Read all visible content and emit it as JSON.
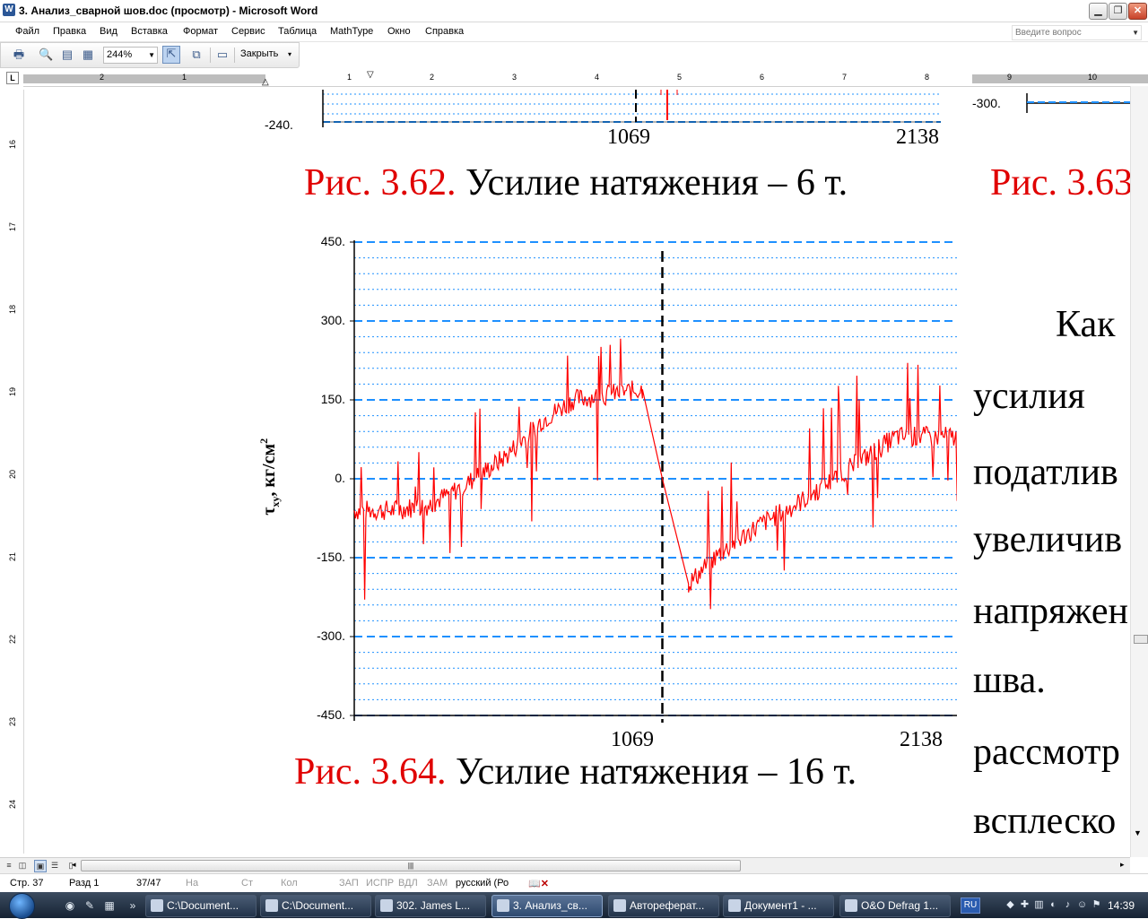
{
  "window": {
    "title": "3. Анализ_сварной шов.doc (просмотр) - Microsoft Word",
    "app_icon": "W"
  },
  "menu": [
    "Файл",
    "Правка",
    "Вид",
    "Вставка",
    "Формат",
    "Сервис",
    "Таблица",
    "MathType",
    "Окно",
    "Справка"
  ],
  "ask_question_placeholder": "Введите вопрос",
  "toolbar": {
    "zoom": "244%",
    "close_label": "Закрыть",
    "icons": [
      "print-icon",
      "magnifier-icon",
      "one-page-icon",
      "multiple-pages-icon",
      "magnifier-toggle-icon",
      "shrink-to-fit-icon",
      "full-screen-icon"
    ]
  },
  "ruler": {
    "corner": "L",
    "h_numbers": [
      "2",
      "1",
      "1",
      "2",
      "3",
      "4",
      "5",
      "6",
      "7",
      "8",
      "9",
      "10"
    ],
    "v_numbers": [
      "16",
      "17",
      "18",
      "19",
      "20",
      "21",
      "22",
      "23",
      "24"
    ]
  },
  "document": {
    "top_chart": {
      "y_label_visible": "-240.",
      "x_ticks": [
        "1069",
        "2138"
      ],
      "right_partial_y_label": "-300."
    },
    "caption_top": {
      "number": "Рис. 3.62.",
      "text": " Усилие натяжения – 6 т."
    },
    "caption_top_right": {
      "number": "Рис. 3.63"
    },
    "main_chart_axis": {
      "y_ticks": [
        "450.",
        "300.",
        "150.",
        "0.",
        "-150.",
        "-300.",
        "-450."
      ],
      "x_ticks": [
        "1069",
        "2138"
      ],
      "ylabel_main": "τ",
      "ylabel_sub": "xy",
      "ylabel_rest": ", кг/см",
      "ylabel_sup": "2"
    },
    "caption_bottom": {
      "number": "Рис. 3.64.",
      "text": " Усилие натяжения – 16 т."
    },
    "body_text": [
      "Как",
      "усилия",
      "податлив",
      "увеличив",
      "напряжен",
      "шва.",
      "рассмотр",
      "всплеско"
    ]
  },
  "chart_data": {
    "type": "line",
    "ylim": [
      -450,
      450
    ],
    "xlim": [
      0,
      2138
    ],
    "x": [
      0,
      1069,
      2138
    ],
    "ylabel": "τxy, кг/см2",
    "yticks": [
      450,
      300,
      150,
      0,
      -150,
      -300,
      -450
    ],
    "xticks": [
      1069,
      2138
    ],
    "vline": 1069,
    "series": [
      {
        "color": "#ff0000",
        "trend_x": [
          0,
          130,
          260,
          390,
          520,
          650,
          760,
          1000,
          1069,
          1160,
          1250,
          1400,
          1560,
          1720,
          1880,
          2000,
          2138
        ],
        "trend_y": [
          -60,
          -60,
          -50,
          -10,
          40,
          110,
          150,
          170,
          0,
          -200,
          -150,
          -90,
          -40,
          20,
          80,
          80,
          80
        ]
      }
    ]
  },
  "status": {
    "page": "Стр. 37",
    "section": "Разд 1",
    "pages": "37/47",
    "at": "На",
    "line": "Ст",
    "col": "Кол",
    "modes": [
      "ЗАП",
      "ИСПР",
      "ВДЛ",
      "ЗАМ"
    ],
    "language": "русский (Ро"
  },
  "taskbar": {
    "tasks": [
      {
        "label": "C:\\Document...",
        "active": false
      },
      {
        "label": "C:\\Document...",
        "active": false
      },
      {
        "label": "302. James L...",
        "active": false
      },
      {
        "label": "3. Анализ_св...",
        "active": true
      },
      {
        "label": "Автореферат...",
        "active": false
      },
      {
        "label": "Документ1 - ...",
        "active": false
      },
      {
        "label": "O&O Defrag 1...",
        "active": false
      }
    ],
    "lang": "RU",
    "time": "14:39"
  }
}
